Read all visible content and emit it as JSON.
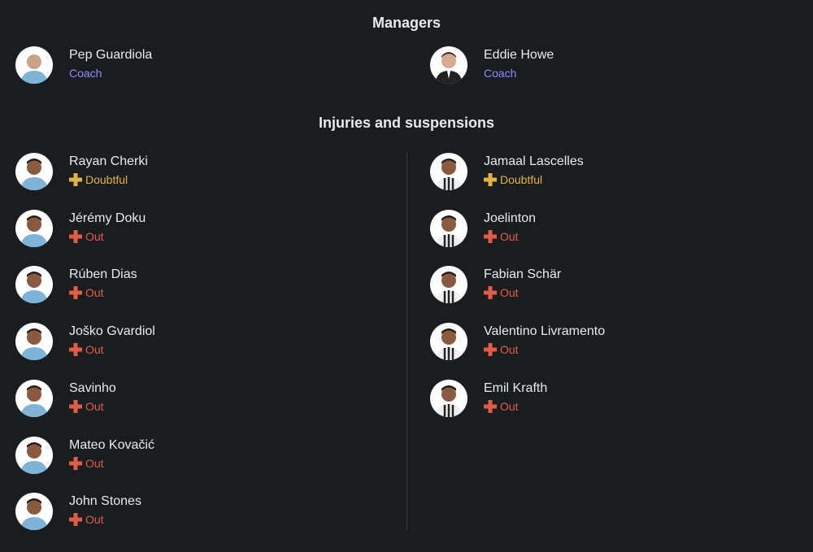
{
  "headings": {
    "managers": "Managers",
    "injuries": "Injuries and suspensions"
  },
  "colors": {
    "doubtful": "#e3b23c",
    "out": "#e25b45",
    "coach": "#8c8cff"
  },
  "managers": [
    {
      "name": "Pep Guardiola",
      "role": "Coach",
      "icon": "avatar-pep-guardiola"
    },
    {
      "name": "Eddie Howe",
      "role": "Coach",
      "icon": "avatar-eddie-howe"
    }
  ],
  "injuries": {
    "home": [
      {
        "name": "Rayan Cherki",
        "status": "Doubtful",
        "kind": "doubtful"
      },
      {
        "name": "Jérémy Doku",
        "status": "Out",
        "kind": "out"
      },
      {
        "name": "Rúben Dias",
        "status": "Out",
        "kind": "out"
      },
      {
        "name": "Joško Gvardiol",
        "status": "Out",
        "kind": "out"
      },
      {
        "name": "Savinho",
        "status": "Out",
        "kind": "out"
      },
      {
        "name": "Mateo Kovačić",
        "status": "Out",
        "kind": "out"
      },
      {
        "name": "John Stones",
        "status": "Out",
        "kind": "out"
      }
    ],
    "away": [
      {
        "name": "Jamaal Lascelles",
        "status": "Doubtful",
        "kind": "doubtful"
      },
      {
        "name": "Joelinton",
        "status": "Out",
        "kind": "out"
      },
      {
        "name": "Fabian Schär",
        "status": "Out",
        "kind": "out"
      },
      {
        "name": "Valentino Livramento",
        "status": "Out",
        "kind": "out"
      },
      {
        "name": "Emil Krafth",
        "status": "Out",
        "kind": "out"
      }
    ]
  }
}
